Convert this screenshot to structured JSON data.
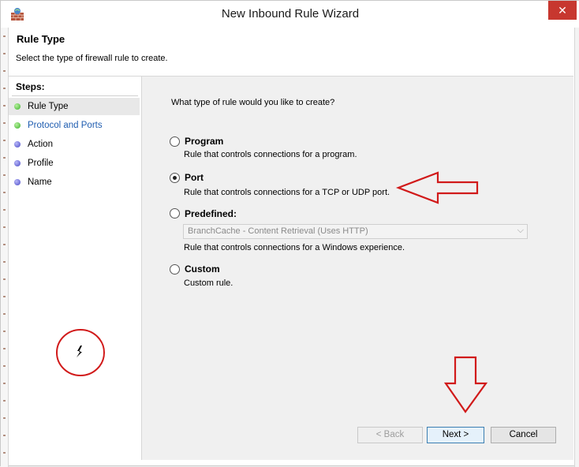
{
  "window": {
    "title": "New Inbound Rule Wizard",
    "close_glyph": "✕"
  },
  "header": {
    "title": "Rule Type",
    "description": "Select the type of firewall rule to create."
  },
  "steps": {
    "heading": "Steps:",
    "items": [
      {
        "label": "Rule Type",
        "status": "green",
        "active": true
      },
      {
        "label": "Protocol and Ports",
        "status": "green",
        "active": false
      },
      {
        "label": "Action",
        "status": "blue",
        "active": false
      },
      {
        "label": "Profile",
        "status": "blue",
        "active": false
      },
      {
        "label": "Name",
        "status": "blue",
        "active": false
      }
    ]
  },
  "content": {
    "question": "What type of rule would you like to create?",
    "options": [
      {
        "label": "Program",
        "description": "Rule that controls connections for a program.",
        "checked": false
      },
      {
        "label": "Port",
        "description": "Rule that controls connections for a TCP or UDP port.",
        "checked": true
      },
      {
        "label": "Predefined:",
        "description": "Rule that controls connections for a Windows experience.",
        "checked": false
      },
      {
        "label": "Custom",
        "description": "Custom rule.",
        "checked": false
      }
    ],
    "predefined_select": {
      "value": "BranchCache - Content Retrieval (Uses HTTP)",
      "disabled": true
    }
  },
  "buttons": {
    "back": "< Back",
    "next": "Next >",
    "cancel": "Cancel"
  },
  "annotations": {
    "color": "#d11a1a"
  }
}
